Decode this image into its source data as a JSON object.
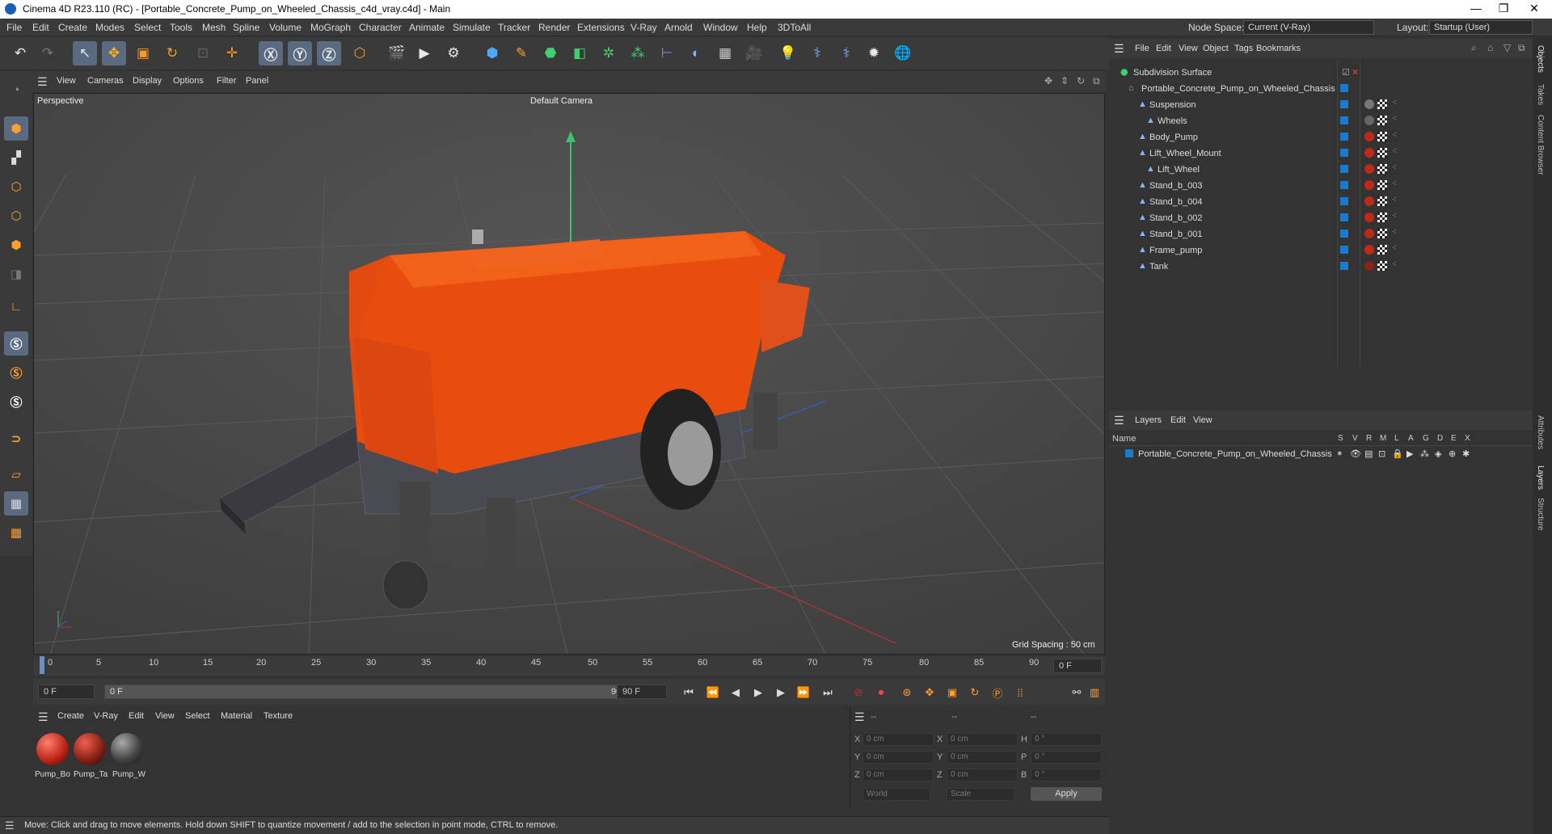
{
  "window": {
    "title": "Cinema 4D R23.110 (RC) - [Portable_Concrete_Pump_on_Wheeled_Chassis_c4d_vray.c4d] - Main",
    "minimize": "—",
    "maximize": "❐",
    "close": "✕"
  },
  "menubar": {
    "items": [
      "File",
      "Edit",
      "Create",
      "Modes",
      "Select",
      "Tools",
      "Mesh",
      "Spline",
      "Volume",
      "MoGraph",
      "Character",
      "Animate",
      "Simulate",
      "Tracker",
      "Render",
      "Extensions",
      "V-Ray",
      "Arnold",
      "Window",
      "Help",
      "3DToAll"
    ],
    "node_space_label": "Node Space:",
    "node_space_value": "Current (V-Ray)",
    "layout_label": "Layout:",
    "layout_value": "Startup (User)"
  },
  "viewport": {
    "menu": [
      "View",
      "Cameras",
      "Display",
      "Options",
      "Filter",
      "Panel"
    ],
    "projection": "Perspective",
    "camera": "Default Camera",
    "grid_spacing": "Grid Spacing : 50 cm"
  },
  "timeline": {
    "ticks": [
      "0",
      "5",
      "10",
      "15",
      "20",
      "25",
      "30",
      "35",
      "40",
      "45",
      "50",
      "55",
      "60",
      "65",
      "70",
      "75",
      "80",
      "85",
      "90"
    ],
    "current_frame": "0 F"
  },
  "playback": {
    "start": "0 F",
    "range_start": "0 F",
    "range_end": "90 F",
    "end": "90 F"
  },
  "material_panel": {
    "menu": [
      "Create",
      "V-Ray",
      "Edit",
      "View",
      "Select",
      "Material",
      "Texture"
    ],
    "materials": [
      {
        "label": "Pump_Bo",
        "color": "#c0281a"
      },
      {
        "label": "Pump_Ta",
        "color": "#8a2218"
      },
      {
        "label": "Pump_W",
        "color": "#444444"
      }
    ]
  },
  "coordinates": {
    "col_headers": [
      "--",
      "--",
      "--"
    ],
    "rows": [
      {
        "a": "X",
        "av": "0 cm",
        "b": "X",
        "bv": "0 cm",
        "c": "H",
        "cv": "0 °"
      },
      {
        "a": "Y",
        "av": "0 cm",
        "b": "Y",
        "bv": "0 cm",
        "c": "P",
        "cv": "0 °"
      },
      {
        "a": "Z",
        "av": "0 cm",
        "b": "Z",
        "bv": "0 cm",
        "c": "B",
        "cv": "0 °"
      }
    ],
    "space": "World",
    "mode": "Scale",
    "apply": "Apply"
  },
  "status": "Move: Click and drag to move elements. Hold down SHIFT to quantize movement / add to the selection in point mode, CTRL to remove.",
  "objects_panel": {
    "menu": [
      "File",
      "Edit",
      "View",
      "Object",
      "Tags",
      "Bookmarks"
    ],
    "items": [
      {
        "name": "Subdivision Surface"
      },
      {
        "name": "Portable_Concrete_Pump_on_Wheeled_Chassis"
      },
      {
        "name": "Suspension"
      },
      {
        "name": "Wheels"
      },
      {
        "name": "Body_Pump"
      },
      {
        "name": "Lift_Wheel_Mount"
      },
      {
        "name": "Lift_Wheel"
      },
      {
        "name": "Stand_b_003"
      },
      {
        "name": "Stand_b_004"
      },
      {
        "name": "Stand_b_002"
      },
      {
        "name": "Stand_b_001"
      },
      {
        "name": "Frame_pump"
      },
      {
        "name": "Tank"
      }
    ]
  },
  "layers_panel": {
    "menu": [
      "Layers",
      "Edit",
      "View"
    ],
    "name_header": "Name",
    "col_headers": [
      "S",
      "V",
      "R",
      "M",
      "L",
      "A",
      "G",
      "D",
      "E",
      "X"
    ],
    "layer_name": "Portable_Concrete_Pump_on_Wheeled_Chassis"
  },
  "side_tabs": [
    "Objects",
    "Takes",
    "Content Browser",
    "Attributes",
    "Layers",
    "Structure"
  ]
}
